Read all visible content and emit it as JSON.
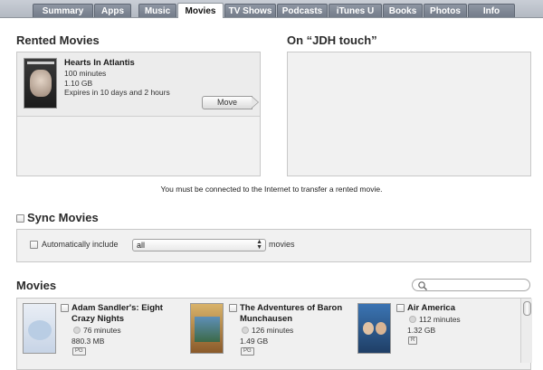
{
  "tabs": [
    {
      "label": "Summary",
      "active": false
    },
    {
      "label": "Apps",
      "active": false
    },
    {
      "label": "Music",
      "active": false
    },
    {
      "label": "Movies",
      "active": true
    },
    {
      "label": "TV Shows",
      "active": false
    },
    {
      "label": "Podcasts",
      "active": false
    },
    {
      "label": "iTunes U",
      "active": false
    },
    {
      "label": "Books",
      "active": false
    },
    {
      "label": "Photos",
      "active": false
    },
    {
      "label": "Info",
      "active": false
    }
  ],
  "rented": {
    "title": "Rented Movies",
    "item": {
      "title": "Hearts In Atlantis",
      "duration": "100 minutes",
      "size": "1.10 GB",
      "expires": "Expires in 10 days and 2 hours",
      "move_label": "Move"
    }
  },
  "device": {
    "title": "On “JDH touch”"
  },
  "notice": "You must be connected to the Internet to transfer a rented movie.",
  "sync": {
    "label": "Sync Movies",
    "auto_label": "Automatically include",
    "auto_value": "all",
    "suffix": "movies"
  },
  "movies": {
    "title": "Movies",
    "items": [
      {
        "title_line1": "Adam Sandler's: Eight",
        "title_line2": "Crazy Nights",
        "duration": "76 minutes",
        "size": "880.3 MB",
        "rating": "PG"
      },
      {
        "title_line1": "The Adventures of Baron",
        "title_line2": "Munchausen",
        "duration": "126 minutes",
        "size": "1.49 GB",
        "rating": "PG"
      },
      {
        "title_line1": "Air America",
        "title_line2": "",
        "duration": "112 minutes",
        "size": "1.32 GB",
        "rating": "R"
      }
    ]
  },
  "colors": {
    "tab_bg": "#7f8895",
    "panel_bg": "#f1f1f1",
    "panel_border": "#c8c8c8"
  }
}
